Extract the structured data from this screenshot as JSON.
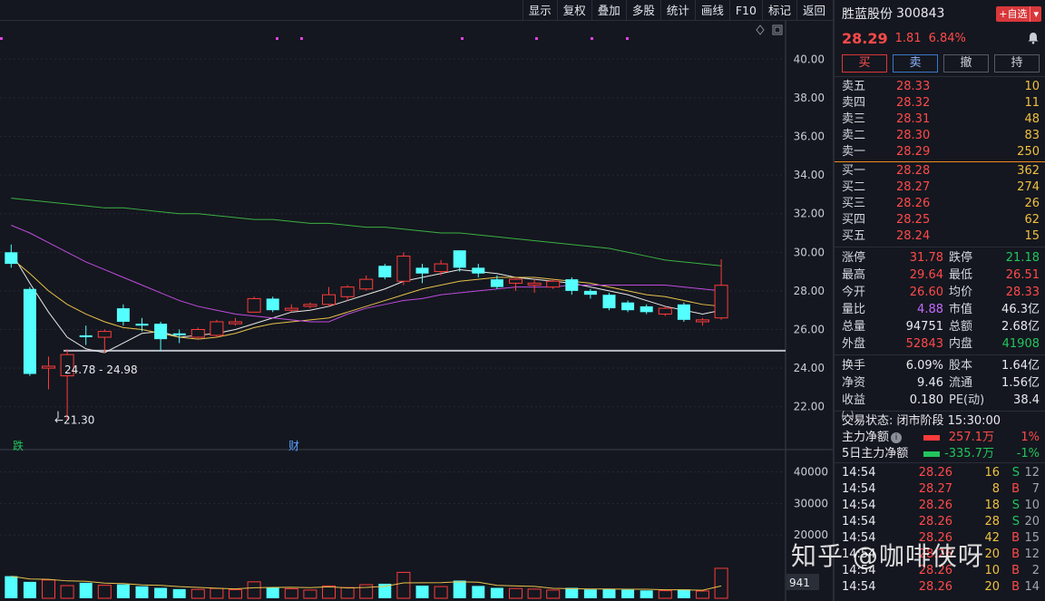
{
  "toolbar": {
    "buttons": [
      "显示",
      "复权",
      "叠加",
      "多股",
      "统计",
      "画线",
      "F10",
      "标记",
      "返回"
    ]
  },
  "chart": {
    "price_axis": [
      "40.00",
      "38.00",
      "36.00",
      "34.00",
      "32.00",
      "30.00",
      "28.00",
      "26.00",
      "24.00",
      "22.00"
    ],
    "volume_axis": [
      "40000",
      "30000",
      "20000"
    ],
    "volume_current": "941",
    "annotation_range": "24.78 - 24.98",
    "annotation_low": "←21.30",
    "event_die": "跌",
    "event_cai": "财"
  },
  "chart_data": {
    "type": "candlestick",
    "ylim": [
      21,
      41
    ],
    "volume_ylim": [
      0,
      45000
    ],
    "candles": [
      {
        "o": 30.0,
        "c": 29.4,
        "h": 30.4,
        "l": 29.2,
        "v": 7000
      },
      {
        "o": 28.1,
        "c": 23.7,
        "h": 28.2,
        "l": 23.6,
        "v": 5200
      },
      {
        "o": 24.0,
        "c": 24.1,
        "h": 24.6,
        "l": 22.9,
        "v": 5800
      },
      {
        "o": 23.6,
        "c": 24.7,
        "h": 24.98,
        "l": 21.3,
        "v": 4000
      },
      {
        "o": 25.7,
        "c": 25.6,
        "h": 26.2,
        "l": 25.2,
        "v": 4900
      },
      {
        "o": 25.6,
        "c": 25.9,
        "h": 26.0,
        "l": 24.78,
        "v": 4100
      },
      {
        "o": 27.1,
        "c": 26.4,
        "h": 27.3,
        "l": 26.2,
        "v": 4400
      },
      {
        "o": 26.3,
        "c": 26.2,
        "h": 26.6,
        "l": 25.9,
        "v": 3800
      },
      {
        "o": 26.3,
        "c": 25.5,
        "h": 26.4,
        "l": 24.9,
        "v": 3300
      },
      {
        "o": 25.8,
        "c": 25.7,
        "h": 26.0,
        "l": 25.3,
        "v": 2900
      },
      {
        "o": 25.6,
        "c": 26.0,
        "h": 26.1,
        "l": 25.5,
        "v": 2800
      },
      {
        "o": 25.7,
        "c": 26.4,
        "h": 26.5,
        "l": 25.6,
        "v": 3100
      },
      {
        "o": 26.3,
        "c": 26.4,
        "h": 26.6,
        "l": 26.2,
        "v": 2700
      },
      {
        "o": 26.9,
        "c": 27.6,
        "h": 27.7,
        "l": 26.9,
        "v": 5200
      },
      {
        "o": 27.6,
        "c": 27.0,
        "h": 27.7,
        "l": 26.9,
        "v": 3400
      },
      {
        "o": 27.0,
        "c": 27.1,
        "h": 27.3,
        "l": 26.9,
        "v": 3000
      },
      {
        "o": 27.2,
        "c": 27.3,
        "h": 27.4,
        "l": 27.1,
        "v": 2600
      },
      {
        "o": 27.3,
        "c": 27.8,
        "h": 28.2,
        "l": 27.2,
        "v": 3900
      },
      {
        "o": 27.7,
        "c": 28.2,
        "h": 28.3,
        "l": 27.5,
        "v": 3400
      },
      {
        "o": 28.1,
        "c": 28.6,
        "h": 28.8,
        "l": 28.0,
        "v": 4300
      },
      {
        "o": 29.3,
        "c": 28.7,
        "h": 29.4,
        "l": 28.6,
        "v": 4600
      },
      {
        "o": 28.5,
        "c": 29.8,
        "h": 30.0,
        "l": 28.3,
        "v": 8200
      },
      {
        "o": 29.2,
        "c": 28.9,
        "h": 29.4,
        "l": 28.4,
        "v": 4000
      },
      {
        "o": 29.0,
        "c": 29.4,
        "h": 29.6,
        "l": 28.8,
        "v": 3700
      },
      {
        "o": 30.1,
        "c": 29.2,
        "h": 30.1,
        "l": 29.0,
        "v": 5600
      },
      {
        "o": 29.2,
        "c": 28.9,
        "h": 29.4,
        "l": 28.7,
        "v": 3900
      },
      {
        "o": 28.6,
        "c": 28.2,
        "h": 28.8,
        "l": 28.1,
        "v": 3300
      },
      {
        "o": 28.4,
        "c": 28.6,
        "h": 28.7,
        "l": 28.0,
        "v": 3100
      },
      {
        "o": 28.3,
        "c": 28.4,
        "h": 28.6,
        "l": 27.9,
        "v": 2900
      },
      {
        "o": 28.2,
        "c": 28.5,
        "h": 28.6,
        "l": 28.1,
        "v": 2600
      },
      {
        "o": 28.6,
        "c": 28.0,
        "h": 28.7,
        "l": 27.8,
        "v": 3300
      },
      {
        "o": 28.0,
        "c": 27.8,
        "h": 28.1,
        "l": 27.6,
        "v": 2800
      },
      {
        "o": 27.8,
        "c": 27.1,
        "h": 27.9,
        "l": 27.0,
        "v": 3000
      },
      {
        "o": 27.4,
        "c": 27.0,
        "h": 27.5,
        "l": 26.9,
        "v": 2700
      },
      {
        "o": 27.2,
        "c": 26.9,
        "h": 27.3,
        "l": 26.8,
        "v": 2500
      },
      {
        "o": 26.8,
        "c": 27.1,
        "h": 27.2,
        "l": 26.7,
        "v": 2400
      },
      {
        "o": 27.3,
        "c": 26.5,
        "h": 27.4,
        "l": 26.4,
        "v": 2800
      },
      {
        "o": 26.4,
        "c": 26.5,
        "h": 26.6,
        "l": 26.2,
        "v": 2300
      },
      {
        "o": 26.6,
        "c": 28.29,
        "h": 29.64,
        "l": 26.51,
        "v": 9475
      }
    ],
    "ma_lines": [
      {
        "color": "#e8e8e8",
        "values": [
          30.0,
          28.4,
          26.9,
          25.6,
          25.0,
          24.8,
          25.3,
          25.8,
          25.9,
          25.6,
          25.7,
          25.8,
          26.0,
          26.3,
          26.6,
          26.9,
          27.0,
          27.2,
          27.5,
          27.8,
          28.1,
          28.5,
          28.7,
          28.9,
          29.1,
          29.0,
          28.9,
          28.7,
          28.6,
          28.5,
          28.4,
          28.2,
          28.0,
          27.8,
          27.5,
          27.2,
          27.0,
          26.8,
          27.0
        ]
      },
      {
        "color": "#e8c14a",
        "values": [
          29.7,
          28.9,
          28.0,
          27.3,
          26.8,
          26.4,
          26.1,
          26.0,
          25.8,
          25.6,
          25.5,
          25.6,
          25.8,
          26.1,
          26.3,
          26.4,
          26.5,
          26.6,
          26.9,
          27.2,
          27.5,
          27.8,
          28.1,
          28.3,
          28.5,
          28.6,
          28.7,
          28.7,
          28.7,
          28.6,
          28.5,
          28.4,
          28.2,
          28.0,
          27.8,
          27.7,
          27.5,
          27.3,
          27.2
        ]
      },
      {
        "color": "#c04be0",
        "values": [
          31.4,
          31.0,
          30.5,
          30.0,
          29.5,
          29.1,
          28.7,
          28.3,
          27.9,
          27.5,
          27.2,
          27.0,
          26.8,
          26.7,
          26.6,
          26.5,
          26.4,
          26.4,
          26.8,
          27.1,
          27.3,
          27.5,
          27.6,
          27.8,
          27.9,
          28.0,
          28.1,
          28.2,
          28.2,
          28.2,
          28.3,
          28.3,
          28.3,
          28.3,
          28.3,
          28.3,
          28.2,
          28.1,
          28.0
        ]
      },
      {
        "color": "#3cb043",
        "values": [
          32.8,
          32.7,
          32.6,
          32.5,
          32.4,
          32.3,
          32.3,
          32.2,
          32.1,
          32.0,
          32.0,
          31.9,
          31.8,
          31.7,
          31.7,
          31.6,
          31.5,
          31.5,
          31.4,
          31.3,
          31.3,
          31.2,
          31.1,
          31.0,
          31.0,
          30.9,
          30.8,
          30.7,
          30.6,
          30.5,
          30.4,
          30.3,
          30.2,
          30.0,
          29.8,
          29.6,
          29.5,
          29.4,
          29.3
        ]
      }
    ],
    "support_line": 24.9
  },
  "panel": {
    "name": "胜蓝股份",
    "code": "300843",
    "add_fav": "+自选",
    "price": "28.29",
    "change": "1.81",
    "change_pct": "6.84%",
    "buy_btn": "买",
    "sell_btn": "卖",
    "cancel_btn": "撤",
    "hold_btn": "持",
    "asks": [
      {
        "label": "卖五",
        "price": "28.33",
        "vol": "10"
      },
      {
        "label": "卖四",
        "price": "28.32",
        "vol": "11"
      },
      {
        "label": "卖三",
        "price": "28.31",
        "vol": "48"
      },
      {
        "label": "卖二",
        "price": "28.30",
        "vol": "83"
      },
      {
        "label": "卖一",
        "price": "28.29",
        "vol": "250"
      }
    ],
    "bids": [
      {
        "label": "买一",
        "price": "28.28",
        "vol": "362"
      },
      {
        "label": "买二",
        "price": "28.27",
        "vol": "274"
      },
      {
        "label": "买三",
        "price": "28.26",
        "vol": "26"
      },
      {
        "label": "买四",
        "price": "28.25",
        "vol": "62"
      },
      {
        "label": "买五",
        "price": "28.24",
        "vol": "15"
      }
    ],
    "stats": [
      {
        "k1": "涨停",
        "v1": "31.78",
        "c1": "red",
        "k2": "跌停",
        "v2": "21.18",
        "c2": "green"
      },
      {
        "k1": "最高",
        "v1": "29.64",
        "c1": "red",
        "k2": "最低",
        "v2": "26.51",
        "c2": "red"
      },
      {
        "k1": "今开",
        "v1": "26.60",
        "c1": "red",
        "k2": "均价",
        "v2": "28.33",
        "c2": "red"
      },
      {
        "k1": "量比",
        "v1": "4.88",
        "c1": "purple",
        "k2": "市值",
        "v2": "46.3亿",
        "c2": "white"
      },
      {
        "k1": "总量",
        "v1": "94751",
        "c1": "white",
        "k2": "总额",
        "v2": "2.68亿",
        "c2": "white"
      },
      {
        "k1": "外盘",
        "v1": "52843",
        "c1": "red",
        "k2": "内盘",
        "v2": "41908",
        "c2": "green"
      }
    ],
    "stats2": [
      {
        "k1": "换手",
        "v1": "6.09%",
        "c1": "white",
        "k2": "股本",
        "v2": "1.64亿",
        "c2": "white"
      },
      {
        "k1": "净资",
        "v1": "9.46",
        "c1": "white",
        "k2": "流通",
        "v2": "1.56亿",
        "c2": "white"
      },
      {
        "k1": "收益㈠",
        "v1": "0.180",
        "c1": "white",
        "k2": "PE(动)",
        "v2": "38.4",
        "c2": "white"
      }
    ],
    "trade_state": "交易状态: 闭市阶段 15:30:00",
    "flow": [
      {
        "label": "主力净额",
        "value": "257.1万",
        "pct": "1%",
        "color": "red",
        "info": "i"
      },
      {
        "label": "5日主力净额",
        "value": "-335.7万",
        "pct": "-1%",
        "color": "green",
        "info": ""
      }
    ],
    "ticks": [
      {
        "t": "14:54",
        "p": "28.26",
        "v": "16",
        "d": "S",
        "n": "12"
      },
      {
        "t": "14:54",
        "p": "28.27",
        "v": "8",
        "d": "B",
        "n": "7"
      },
      {
        "t": "14:54",
        "p": "28.26",
        "v": "18",
        "d": "S",
        "n": "10"
      },
      {
        "t": "14:54",
        "p": "28.26",
        "v": "28",
        "d": "S",
        "n": "20"
      },
      {
        "t": "14:54",
        "p": "28.26",
        "v": "42",
        "d": "B",
        "n": "15"
      },
      {
        "t": "14:54",
        "p": "28.26",
        "v": "20",
        "d": "B",
        "n": "12"
      },
      {
        "t": "14:54",
        "p": "28.26",
        "v": "10",
        "d": "B",
        "n": "2"
      },
      {
        "t": "14:54",
        "p": "28.26",
        "v": "20",
        "d": "B",
        "n": "14"
      }
    ]
  },
  "watermark": "知乎 @咖啡侠呀"
}
